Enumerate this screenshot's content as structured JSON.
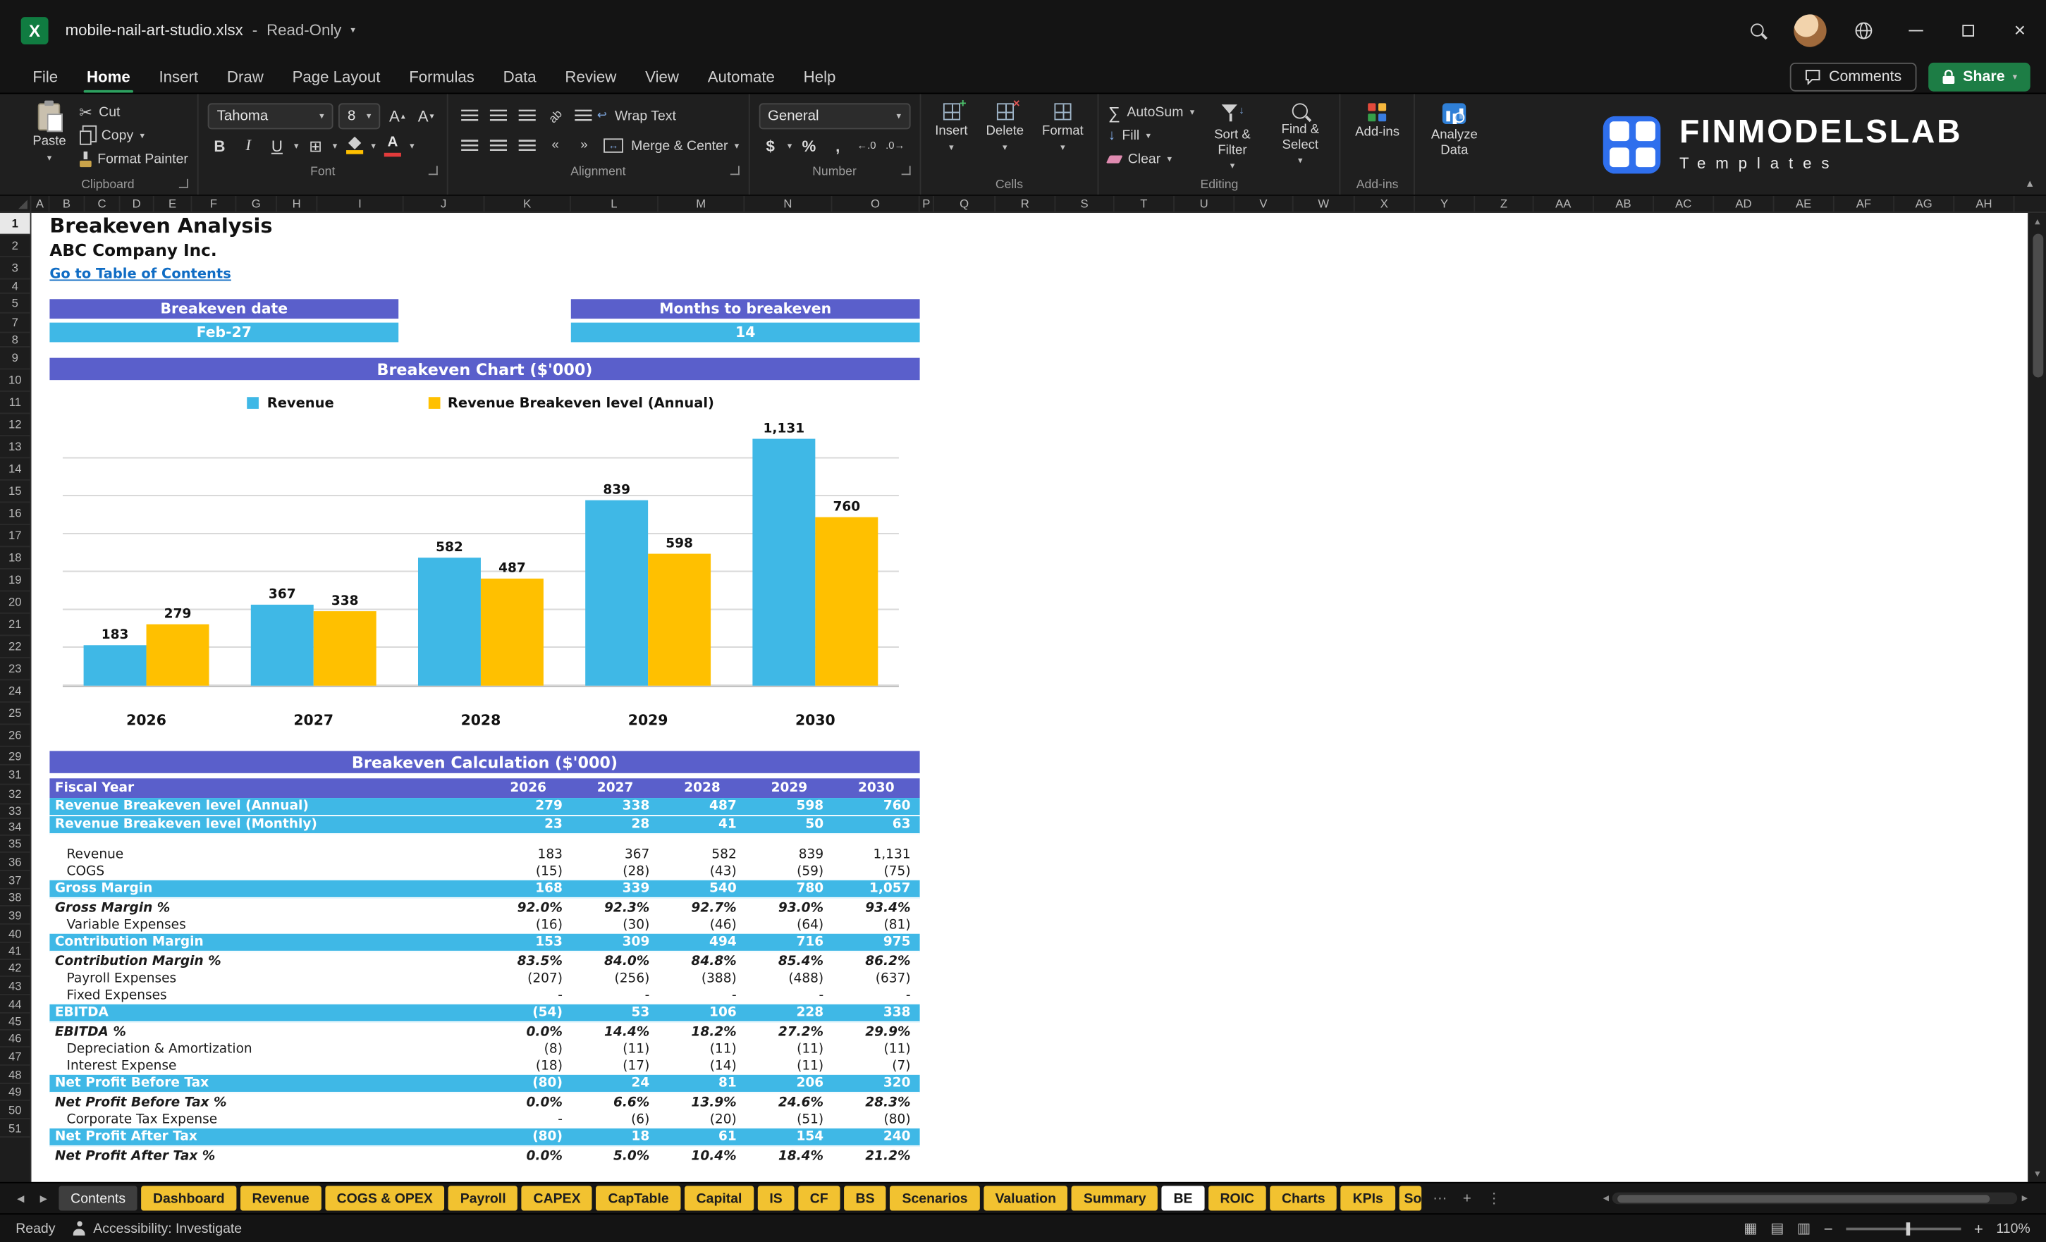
{
  "colors": {
    "purple": "#5a5fcb",
    "blue": "#3fb8e6",
    "gold": "#ffc000",
    "tab_yellow": "#f2c230",
    "share_green": "#1d7d45",
    "link_blue": "#0f6cc4",
    "logo_blue": "#2f6fed",
    "excel_green": "#107c41"
  },
  "titlebar": {
    "app_icon_letter": "X",
    "filename": "mobile-nail-art-studio.xlsx",
    "separator": "-",
    "mode": "Read-Only"
  },
  "ribbon_tabs": {
    "items": [
      "File",
      "Home",
      "Insert",
      "Draw",
      "Page Layout",
      "Formulas",
      "Data",
      "Review",
      "View",
      "Automate",
      "Help"
    ],
    "active": "Home"
  },
  "top_actions": {
    "comments": "Comments",
    "share": "Share"
  },
  "ribbon": {
    "clipboard": {
      "group": "Clipboard",
      "paste": "Paste",
      "cut": "Cut",
      "copy": "Copy",
      "format_painter": "Format Painter"
    },
    "font": {
      "group": "Font",
      "name": "Tahoma",
      "size": "8",
      "bold": "B",
      "italic": "I",
      "underline": "U"
    },
    "alignment": {
      "group": "Alignment",
      "wrap_text": "Wrap Text",
      "merge_center": "Merge & Center"
    },
    "number": {
      "group": "Number",
      "format": "General",
      "currency": "$",
      "percent": "%",
      "comma": ","
    },
    "cells": {
      "group": "Cells",
      "insert": "Insert",
      "delete": "Delete",
      "format": "Format"
    },
    "editing": {
      "group": "Editing",
      "autosum": "AutoSum",
      "fill": "Fill",
      "clear": "Clear",
      "sort_filter": "Sort & Filter",
      "find_select": "Find & Select"
    },
    "addins": {
      "group": "Add-ins",
      "label": "Add-ins",
      "analyze": "Analyze Data"
    }
  },
  "logo": {
    "title": "FINMODELSLAB",
    "subtitle": "Templates"
  },
  "grid": {
    "columns": [
      "A",
      "B",
      "C",
      "D",
      "E",
      "F",
      "G",
      "H",
      "I",
      "J",
      "K",
      "L",
      "M",
      "N",
      "O",
      "P",
      "Q",
      "R",
      "S",
      "T",
      "U",
      "V",
      "W",
      "X",
      "Y",
      "Z",
      "AA",
      "AB",
      "AC",
      "AD",
      "AE",
      "AF",
      "AG",
      "AH"
    ],
    "rows": [
      "1",
      "2",
      "3",
      "4",
      "5",
      "7",
      "8",
      "9",
      "10",
      "11",
      "12",
      "13",
      "14",
      "15",
      "16",
      "17",
      "18",
      "19",
      "20",
      "21",
      "22",
      "23",
      "24",
      "25",
      "26",
      "29",
      "31",
      "32",
      "33",
      "34",
      "35",
      "36",
      "37",
      "38",
      "39",
      "40",
      "41",
      "42",
      "43",
      "44",
      "45",
      "46",
      "47",
      "48",
      "49",
      "50",
      "51"
    ]
  },
  "sheet": {
    "title": "Breakeven Analysis",
    "company": "ABC Company Inc.",
    "toc_link": "Go to Table of Contents",
    "kpi": [
      {
        "label": "Breakeven date",
        "value": "Feb-27"
      },
      {
        "label": "Months to breakeven",
        "value": "14"
      }
    ],
    "chart_header": "Breakeven Chart ($'000)",
    "calc_header": "Breakeven Calculation ($'000)"
  },
  "chart_data": {
    "type": "bar",
    "title": "Breakeven Chart ($'000)",
    "categories": [
      "2026",
      "2027",
      "2028",
      "2029",
      "2030"
    ],
    "series": [
      {
        "name": "Revenue",
        "color": "#3fb8e6",
        "values": [
          183,
          367,
          582,
          839,
          1131
        ],
        "labels": [
          "183",
          "367",
          "582",
          "839",
          "1,131"
        ]
      },
      {
        "name": "Revenue Breakeven level (Annual)",
        "color": "#ffc000",
        "values": [
          279,
          338,
          487,
          598,
          760
        ],
        "labels": [
          "279",
          "338",
          "487",
          "598",
          "760"
        ]
      }
    ],
    "ylim": [
      0,
      1200
    ],
    "gridlines": true,
    "legend_position": "top",
    "value_labels": true
  },
  "calc_table": {
    "header": {
      "label": "Fiscal Year",
      "years": [
        "2026",
        "2027",
        "2028",
        "2029",
        "2030"
      ]
    },
    "rows": [
      {
        "label": "Revenue Breakeven level (Annual)",
        "values": [
          "279",
          "338",
          "487",
          "598",
          "760"
        ],
        "style": "total"
      },
      {
        "label": "Revenue Breakeven level (Monthly)",
        "values": [
          "23",
          "28",
          "41",
          "50",
          "63"
        ],
        "style": "total"
      },
      {
        "label": "",
        "values": [],
        "style": "spacer"
      },
      {
        "label": "Revenue",
        "values": [
          "183",
          "367",
          "582",
          "839",
          "1,131"
        ],
        "style": "plain"
      },
      {
        "label": "COGS",
        "values": [
          "(15)",
          "(28)",
          "(43)",
          "(59)",
          "(75)"
        ],
        "style": "plain"
      },
      {
        "label": "Gross Margin",
        "values": [
          "168",
          "339",
          "540",
          "780",
          "1,057"
        ],
        "style": "total"
      },
      {
        "label": "Gross Margin %",
        "values": [
          "92.0%",
          "92.3%",
          "92.7%",
          "93.0%",
          "93.4%"
        ],
        "style": "pct"
      },
      {
        "label": "Variable Expenses",
        "values": [
          "(16)",
          "(30)",
          "(46)",
          "(64)",
          "(81)"
        ],
        "style": "plain"
      },
      {
        "label": "Contribution Margin",
        "values": [
          "153",
          "309",
          "494",
          "716",
          "975"
        ],
        "style": "total"
      },
      {
        "label": "Contribution Margin %",
        "values": [
          "83.5%",
          "84.0%",
          "84.8%",
          "85.4%",
          "86.2%"
        ],
        "style": "pct"
      },
      {
        "label": "Payroll Expenses",
        "values": [
          "(207)",
          "(256)",
          "(388)",
          "(488)",
          "(637)"
        ],
        "style": "plain"
      },
      {
        "label": "Fixed Expenses",
        "values": [
          "-",
          "-",
          "-",
          "-",
          "-"
        ],
        "style": "plain"
      },
      {
        "label": "EBITDA",
        "values": [
          "(54)",
          "53",
          "106",
          "228",
          "338"
        ],
        "style": "total"
      },
      {
        "label": "EBITDA %",
        "values": [
          "0.0%",
          "14.4%",
          "18.2%",
          "27.2%",
          "29.9%"
        ],
        "style": "pct"
      },
      {
        "label": "Depreciation & Amortization",
        "values": [
          "(8)",
          "(11)",
          "(11)",
          "(11)",
          "(11)"
        ],
        "style": "plain"
      },
      {
        "label": "Interest Expense",
        "values": [
          "(18)",
          "(17)",
          "(14)",
          "(11)",
          "(7)"
        ],
        "style": "plain"
      },
      {
        "label": "Net Profit Before Tax",
        "values": [
          "(80)",
          "24",
          "81",
          "206",
          "320"
        ],
        "style": "total"
      },
      {
        "label": "Net Profit Before Tax %",
        "values": [
          "0.0%",
          "6.6%",
          "13.9%",
          "24.6%",
          "28.3%"
        ],
        "style": "pct"
      },
      {
        "label": "Corporate Tax Expense",
        "values": [
          "-",
          "(6)",
          "(20)",
          "(51)",
          "(80)"
        ],
        "style": "plain"
      },
      {
        "label": "Net Profit After Tax",
        "values": [
          "(80)",
          "18",
          "61",
          "154",
          "240"
        ],
        "style": "total"
      },
      {
        "label": "Net Profit After Tax %",
        "values": [
          "0.0%",
          "5.0%",
          "10.4%",
          "18.4%",
          "21.2%"
        ],
        "style": "pct"
      }
    ]
  },
  "sheet_tabs": {
    "tabs": [
      {
        "label": "Contents",
        "style": "dark"
      },
      {
        "label": "Dashboard",
        "style": "yellow"
      },
      {
        "label": "Revenue",
        "style": "yellow"
      },
      {
        "label": "COGS & OPEX",
        "style": "yellow"
      },
      {
        "label": "Payroll",
        "style": "yellow"
      },
      {
        "label": "CAPEX",
        "style": "yellow"
      },
      {
        "label": "CapTable",
        "style": "yellow"
      },
      {
        "label": "Capital",
        "style": "yellow"
      },
      {
        "label": "IS",
        "style": "yellow"
      },
      {
        "label": "CF",
        "style": "yellow"
      },
      {
        "label": "BS",
        "style": "yellow"
      },
      {
        "label": "Scenarios",
        "style": "yellow"
      },
      {
        "label": "Valuation",
        "style": "yellow"
      },
      {
        "label": "Summary",
        "style": "yellow"
      },
      {
        "label": "BE",
        "style": "active"
      },
      {
        "label": "ROIC",
        "style": "yellow"
      },
      {
        "label": "Charts",
        "style": "yellow"
      },
      {
        "label": "KPIs",
        "style": "yellow"
      },
      {
        "label": "So",
        "style": "yellow-clipped"
      }
    ]
  },
  "status_bar": {
    "ready": "Ready",
    "accessibility": "Accessibility: Investigate",
    "zoom": "110%"
  }
}
